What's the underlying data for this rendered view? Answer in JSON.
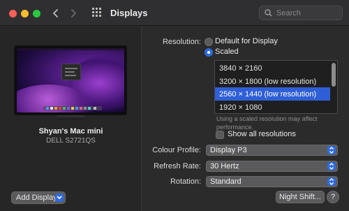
{
  "window": {
    "title": "Displays"
  },
  "search": {
    "placeholder": "Search"
  },
  "display": {
    "name": "Shyan's Mac mini",
    "model": "DELL S2721QS"
  },
  "buttons": {
    "add_display": "Add Display",
    "night_shift": "Night Shift...",
    "help": "?"
  },
  "resolution": {
    "label": "Resolution:",
    "options": [
      {
        "label": "Default for Display",
        "selected": false
      },
      {
        "label": "Scaled",
        "selected": true
      }
    ],
    "list": [
      {
        "label": "3840 × 2160",
        "selected": false
      },
      {
        "label": "3200 × 1800 (low resolution)",
        "selected": false
      },
      {
        "label": "2560 × 1440 (low resolution)",
        "selected": true
      },
      {
        "label": "1920 × 1080",
        "selected": false
      }
    ],
    "note": "Using a scaled resolution may affect performance.",
    "show_all_label": "Show all resolutions",
    "show_all_checked": false
  },
  "colour_profile": {
    "label": "Colour Profile:",
    "value": "Display P3"
  },
  "refresh_rate": {
    "label": "Refresh Rate:",
    "value": "30 Hertz"
  },
  "rotation": {
    "label": "Rotation:",
    "value": "Standard"
  },
  "colors": {
    "accent": "#2f6bdc",
    "selection": "#2f5fd6",
    "window_bg": "#2b2b2b"
  }
}
